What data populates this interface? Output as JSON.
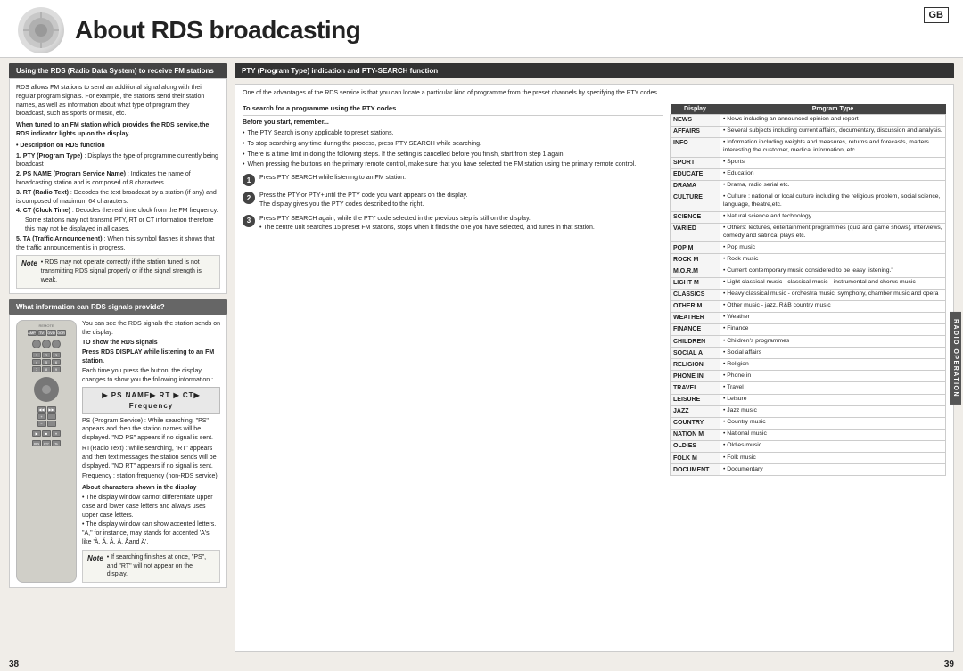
{
  "header": {
    "title": "About RDS broadcasting",
    "gb_label": "GB"
  },
  "left_section1": {
    "header": "Using the RDS (Radio Data System) to receive FM stations",
    "intro": "RDS allows FM stations to send an additional signal along with their regular program signals. For example, the stations send their station names, as well as information about what type of program they broadcast, such as sports or music, etc.",
    "indicator_note": "When tuned to an FM station which provides the RDS service,the RDS indicator lights up on the display.",
    "description_header": "• Description on RDS function",
    "items": [
      "1. PTY (Program Type) : Displays the type of programme currently being broadcast",
      "2. PS NAME (Program Service Name) : Indicates the name of broadcasting station and is composed of 8 characters.",
      "3. RT (Radio Text) : Decodes the text broadcast by a station (if any) and is composed of maximum 64 characters.",
      "4. CT (Clock Time) : Decodes the real time clock from the FM frequency.",
      "Some stations may not transmit PTY, RT or CT information therefore this may not be displayed in all cases.",
      "5. TA (Traffic Announcement) : When this symbol flashes it shows that the traffic announcement is in progress."
    ],
    "note": "• RDS may not operate correctly if the station tuned is not transmitting RDS signal properly or if the signal strength is weak."
  },
  "left_section2": {
    "header": "What information can RDS signals provide?",
    "intro": "You can see the RDS signals the station sends on the display.",
    "to_show_header": "TO show the RDS signals",
    "press_instruction": "Press RDS DISPLAY while listening to an FM station.",
    "each_time": "Each time you press the button, the display changes to show you the following information :",
    "flow": "▶ PS NAME▶  RT ▶  CT▶  Frequency",
    "ps_text": "PS (Program Service) : While searching, \"PS\" appears and then the station names will be displayed. \"NO PS\" appears if no signal is sent.",
    "rt_text": "RT(Radio Text) : while searching, \"RT\" appears and then text messages the station sends will be displayed. \"NO RT\" appears if no signal is sent.",
    "freq_text": "Frequency : station frequency (non-RDS service)",
    "about_header": "About characters shown in the display",
    "about_items": [
      "The display window cannot differentiate upper case and lower case letters and always uses upper case letters.",
      "The display window can show accented letters. \"A,\" for instance, may stands for accented \"A\"s' like 'À, Á, Â, Ä, Åand Ä'."
    ],
    "note2": "• If searching finishes at once, \"PS\", and \"RT\" will not appear on the display."
  },
  "right_section": {
    "header": "PTY (Program Type) indication and PTY-SEARCH function",
    "intro": "One  of the advantages of the RDS service is that you can locate a particular kind of programme from the preset channels by specifying the PTY codes.",
    "search_header": "To search for a programme using the PTY codes",
    "before_start": "Before you start, remember...",
    "bullets": [
      "The PTY Search is only applicable to preset stations.",
      "To stop searching any time during the process, press PTY SEARCH while searching.",
      "There is a time limit in doing the following steps. If the setting is cancelled before you finish, start from step 1 again.",
      "When pressing the buttons on the primary remote control, make sure that you have selected the FM station using the primary remote control."
    ],
    "steps": [
      {
        "num": "1",
        "text": "Press PTY SEARCH while listening to an FM station."
      },
      {
        "num": "2",
        "text": "Press the PTY-or PTY+until the PTY code you want appears on the display.\nThe display gives you the PTY codes described to the right."
      },
      {
        "num": "3",
        "text": "Press PTY SEARCH again, while the PTY code selected in the previous step is still on the display.\n• The centre unit searches 15 preset FM stations, stops when it finds the one you have selected, and tunes in that station."
      }
    ],
    "radio_operation_label": "RADIO OPERATION"
  },
  "pty_table": {
    "col_display": "Display",
    "col_program": "Program Type",
    "rows": [
      {
        "display": "NEWS",
        "program": "• News including an announced opinion and report"
      },
      {
        "display": "AFFAIRS",
        "program": "• Several subjects including current affairs, documentary, discussion and analysis."
      },
      {
        "display": "INFO",
        "program": "• Information including weights and measures, returns and forecasts, matters interesting the customer, medical information, etc"
      },
      {
        "display": "SPORT",
        "program": "• Sports"
      },
      {
        "display": "EDUCATE",
        "program": "• Education"
      },
      {
        "display": "DRAMA",
        "program": "• Drama, radio serial etc."
      },
      {
        "display": "CULTURE",
        "program": "• Culture : national or local culture including the religious problem, social science, language, theatre,etc."
      },
      {
        "display": "SCIENCE",
        "program": "• Natural science and technology"
      },
      {
        "display": "VARIED",
        "program": "• Others: lectures, entertainment programmes (quiz and game shows), interviews, comedy and satirical plays etc."
      },
      {
        "display": "POP M",
        "program": "• Pop music"
      },
      {
        "display": "ROCK M",
        "program": "• Rock music"
      },
      {
        "display": "M.O.R.M",
        "program": "• Current contemporary music considered to be 'easy listening.'"
      },
      {
        "display": "LIGHT M",
        "program": "• Light classical music - classical music - instrumental and chorus music"
      },
      {
        "display": "CLASSICS",
        "program": "• Heavy classical music - orchestra music, symphony, chamber music and opera"
      },
      {
        "display": "OTHER M",
        "program": "• Other music - jazz, R&B country music"
      },
      {
        "display": "WEATHER",
        "program": "• Weather"
      },
      {
        "display": "FINANCE",
        "program": "• Finance"
      },
      {
        "display": "CHILDREN",
        "program": "• Children's programmes"
      },
      {
        "display": "SOCIAL A",
        "program": "• Social affairs"
      },
      {
        "display": "RELIGION",
        "program": "• Religion"
      },
      {
        "display": "PHONE IN",
        "program": "• Phone in"
      },
      {
        "display": "TRAVEL",
        "program": "• Travel"
      },
      {
        "display": "LEISURE",
        "program": "• Leisure"
      },
      {
        "display": "JAZZ",
        "program": "• Jazz music"
      },
      {
        "display": "COUNTRY",
        "program": "• Country music"
      },
      {
        "display": "NATION M",
        "program": "• National music"
      },
      {
        "display": "OLDIES",
        "program": "• Oldies music"
      },
      {
        "display": "FOLK M",
        "program": "• Folk music"
      },
      {
        "display": "DOCUMENT",
        "program": "• Documentary"
      }
    ]
  },
  "page_numbers": {
    "left": "38",
    "right": "39"
  }
}
